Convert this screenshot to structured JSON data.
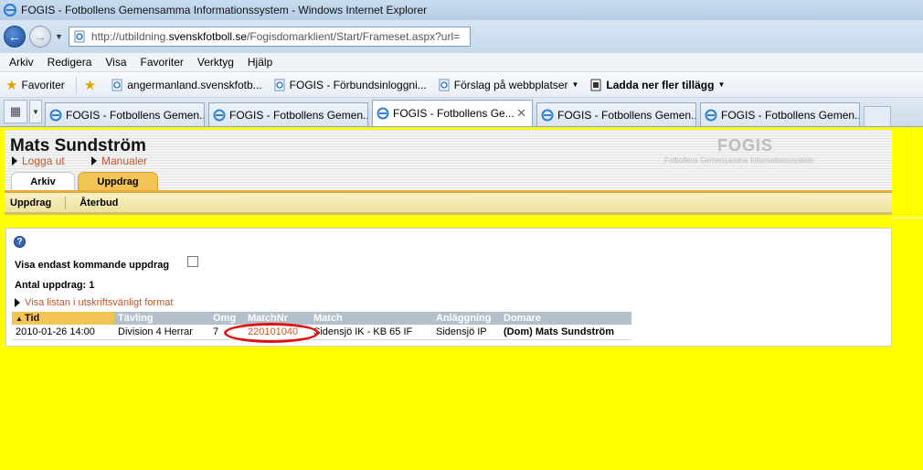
{
  "window": {
    "title": "FOGIS - Fotbollens Gemensamma Informationssystem - Windows Internet Explorer"
  },
  "address": {
    "url_prefix": "http://utbildning.",
    "url_domain": "svenskfotboll.se",
    "url_path": "/Fogisdomarklient/Start/Frameset.aspx?url="
  },
  "menu": {
    "items": [
      "Arkiv",
      "Redigera",
      "Visa",
      "Favoriter",
      "Verktyg",
      "Hjälp"
    ]
  },
  "favorites": {
    "label": "Favoriter",
    "items": [
      "angermanland.svenskfotb...",
      "FOGIS - Förbundsinloggni...",
      "Förslag på webbplatser",
      "Ladda ner fler tillägg"
    ]
  },
  "tabs": [
    {
      "label": "FOGIS - Fotbollens Gemen..."
    },
    {
      "label": "FOGIS - Fotbollens Gemen..."
    },
    {
      "label": "FOGIS - Fotbollens Ge..."
    },
    {
      "label": "FOGIS - Fotbollens Gemen..."
    },
    {
      "label": "FOGIS - Fotbollens Gemen..."
    }
  ],
  "header": {
    "user_name": "Mats Sundström",
    "logout": "Logga ut",
    "manuals": "Manualer",
    "logo": "FOGIS",
    "logo_sub": "Fotbollens Gemensamma Informationssystem",
    "tab_archive": "Arkiv",
    "tab_assignments": "Uppdrag"
  },
  "subnav": {
    "items": [
      "Uppdrag",
      "Återbud"
    ]
  },
  "content": {
    "help": "?",
    "upcoming_only": "Visa endast kommande uppdrag",
    "count_label": "Antal uppdrag: 1",
    "print_link": "Visa listan i utskriftsvänligt format"
  },
  "table": {
    "columns": [
      "Tid",
      "Tävling",
      "Omg",
      "MatchNr",
      "Match",
      "Anläggning",
      "Domare"
    ],
    "rows": [
      {
        "tid": "2010-01-26 14:00",
        "tavling": "Division 4 Herrar",
        "omg": "7",
        "matchnr": "220101040",
        "match": "Sidensjö IK - KB 65 IF",
        "anlaggning": "Sidensjö IP",
        "domare": "(Dom) Mats Sundström"
      }
    ]
  },
  "colors": {
    "page_background": "#ffff00",
    "accent_orange": "#f2c455",
    "link_color": "#c0572a",
    "highlight_red": "#e01010"
  }
}
